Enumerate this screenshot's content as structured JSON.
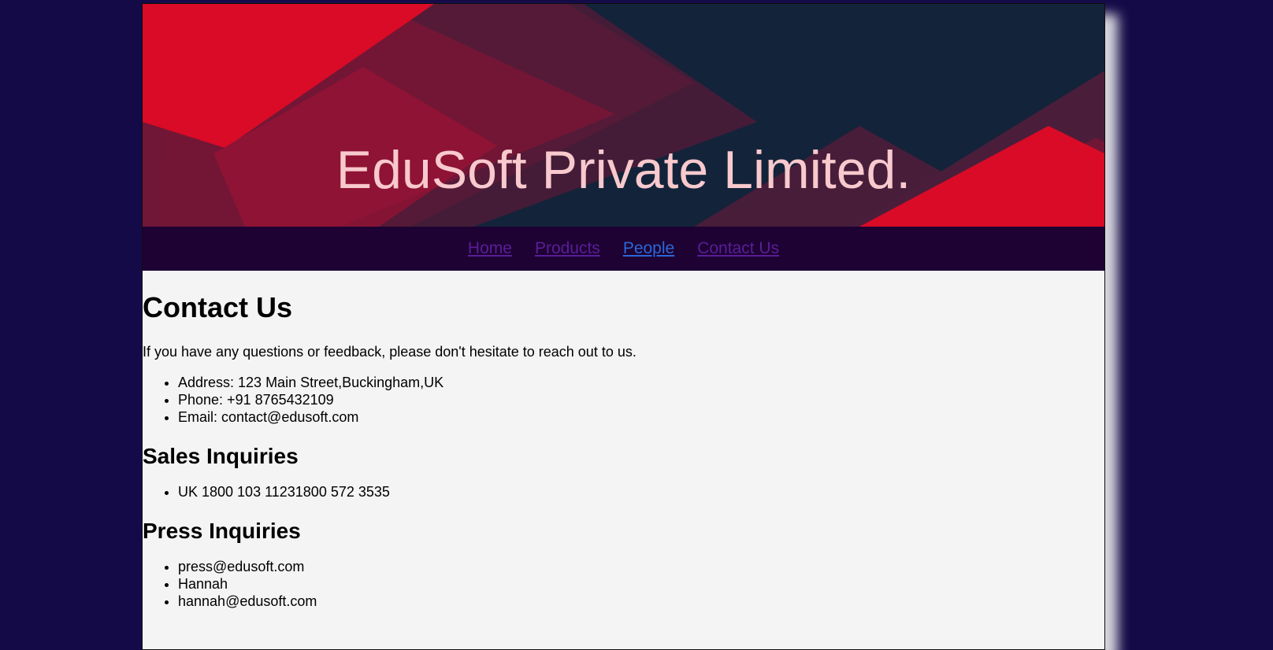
{
  "banner": {
    "title": "EduSoft Private Limited."
  },
  "nav": {
    "items": [
      {
        "label": "Home"
      },
      {
        "label": "Products"
      },
      {
        "label": "People"
      },
      {
        "label": "Contact Us"
      }
    ]
  },
  "content": {
    "heading": "Contact Us",
    "intro": "If you have any questions or feedback, please don't hesitate to reach out to us.",
    "contact_items": [
      "Address: 123 Main Street,Buckingham,UK",
      "Phone: +91 8765432109",
      "Email: contact@edusoft.com"
    ],
    "sales_heading": "Sales Inquiries",
    "sales_items": [
      "UK 1800 103 11231800 572 3535"
    ],
    "press_heading": "Press Inquiries",
    "press_items": [
      "press@edusoft.com",
      "Hannah",
      "hannah@edusoft.com"
    ]
  },
  "colors": {
    "background": "#140a47",
    "banner_bg": "#13233a",
    "banner_red": "#d90b26",
    "banner_title": "#f8c9cd",
    "nav_bg": "#1e0233",
    "nav_link": "#5a1d9a",
    "nav_link_active": "#2a67d8",
    "content_bg": "#f4f4f4"
  }
}
